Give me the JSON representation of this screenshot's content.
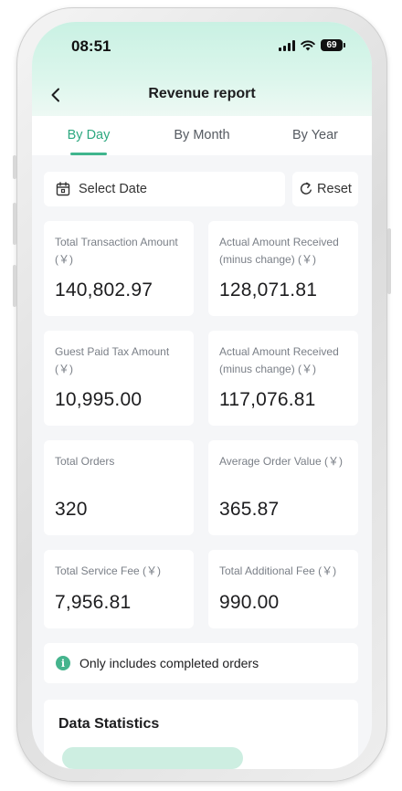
{
  "status_bar": {
    "time": "08:51",
    "battery": "69"
  },
  "nav": {
    "title": "Revenue report"
  },
  "tabs": [
    {
      "label": "By Day",
      "active": true
    },
    {
      "label": "By Month",
      "active": false
    },
    {
      "label": "By Year",
      "active": false
    }
  ],
  "filter": {
    "date_placeholder": "Select Date",
    "reset_label": "Reset"
  },
  "metrics": [
    {
      "label": "Total Transaction Amount (￥)",
      "value": "140,802.97"
    },
    {
      "label": "Actual Amount Received (minus change) (￥)",
      "value": "128,071.81"
    },
    {
      "label": "Guest Paid Tax Amount (￥)",
      "value": "10,995.00"
    },
    {
      "label": "Actual Amount Received (minus change) (￥)",
      "value": "117,076.81"
    },
    {
      "label": "Total Orders",
      "value": "320"
    },
    {
      "label": "Average Order Value (￥)",
      "value": "365.87"
    },
    {
      "label": "Total Service Fee (￥)",
      "value": "7,956.81"
    },
    {
      "label": "Total Additional Fee (￥)",
      "value": "990.00"
    }
  ],
  "notice": {
    "text": "Only includes completed orders"
  },
  "statistics": {
    "title": "Data Statistics"
  },
  "colors": {
    "accent": "#3fb58d",
    "header_gradient_top": "#c9f1e3",
    "background": "#f5f6f8"
  }
}
